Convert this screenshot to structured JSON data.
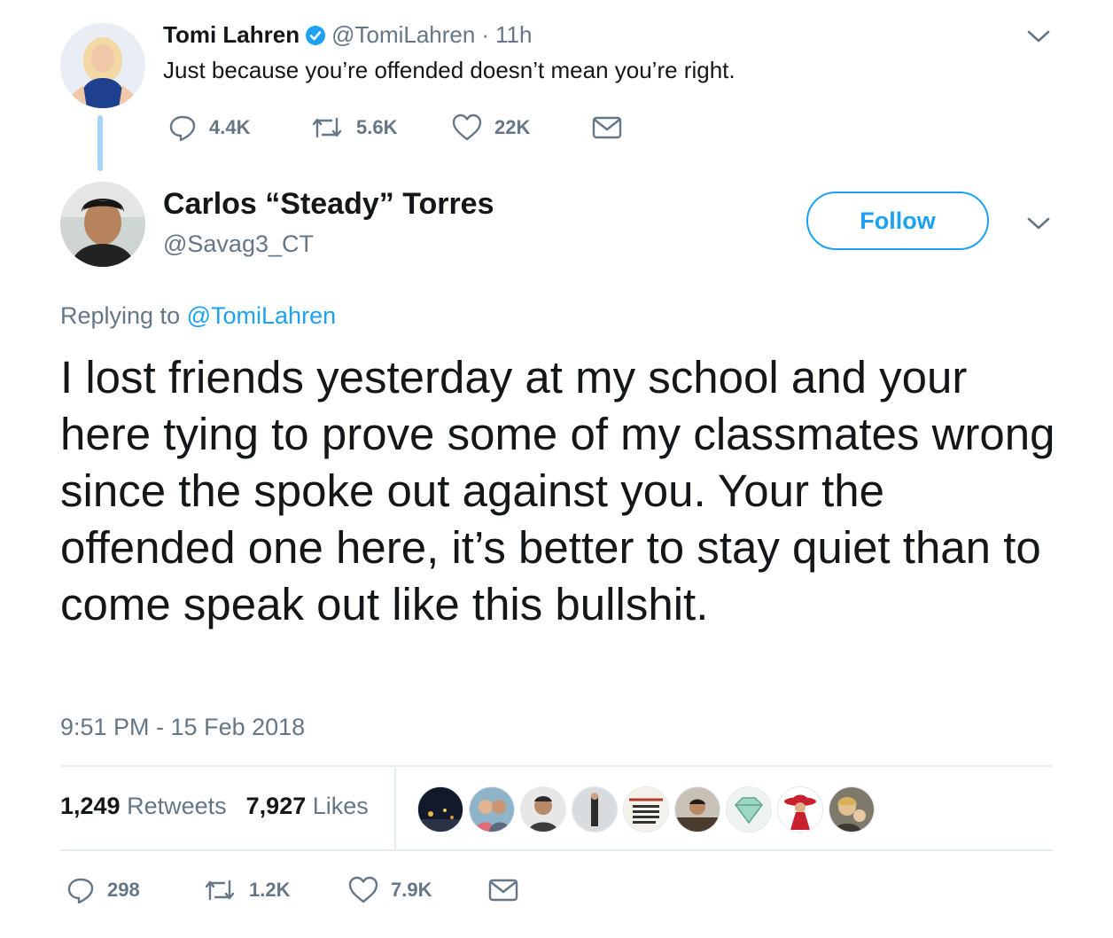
{
  "parent_tweet": {
    "author_name": "Tomi Lahren",
    "handle": "@TomiLahren",
    "separator": "·",
    "time": "11h",
    "text": "Just because you’re offended doesn’t mean you’re right.",
    "replies": "4.4K",
    "retweets": "5.6K",
    "likes": "22K"
  },
  "main_tweet": {
    "author_name": "Carlos “Steady” Torres",
    "handle": "@Savag3_CT",
    "follow_label": "Follow",
    "replying_prefix": "Replying to",
    "replying_handle": "@TomiLahren",
    "text": "I lost friends yesterday at my school and your here tying to prove some of my classmates wrong since the spoke out against you. Your the offended one here, it’s better to stay quiet than to come speak out like this bullshit.",
    "timestamp": "9:51 PM - 15 Feb 2018",
    "retweet_count": "1,249",
    "retweet_label": "Retweets",
    "like_count": "7,927",
    "like_label": "Likes",
    "reply_action_count": "298",
    "retweet_action_count": "1.2K",
    "like_action_count": "7.9K"
  },
  "colors": {
    "accent": "#1da1f2",
    "muted": "#657786",
    "text": "#14171a",
    "thread_line": "#a6d4fa",
    "verified": "#1da1f2"
  }
}
